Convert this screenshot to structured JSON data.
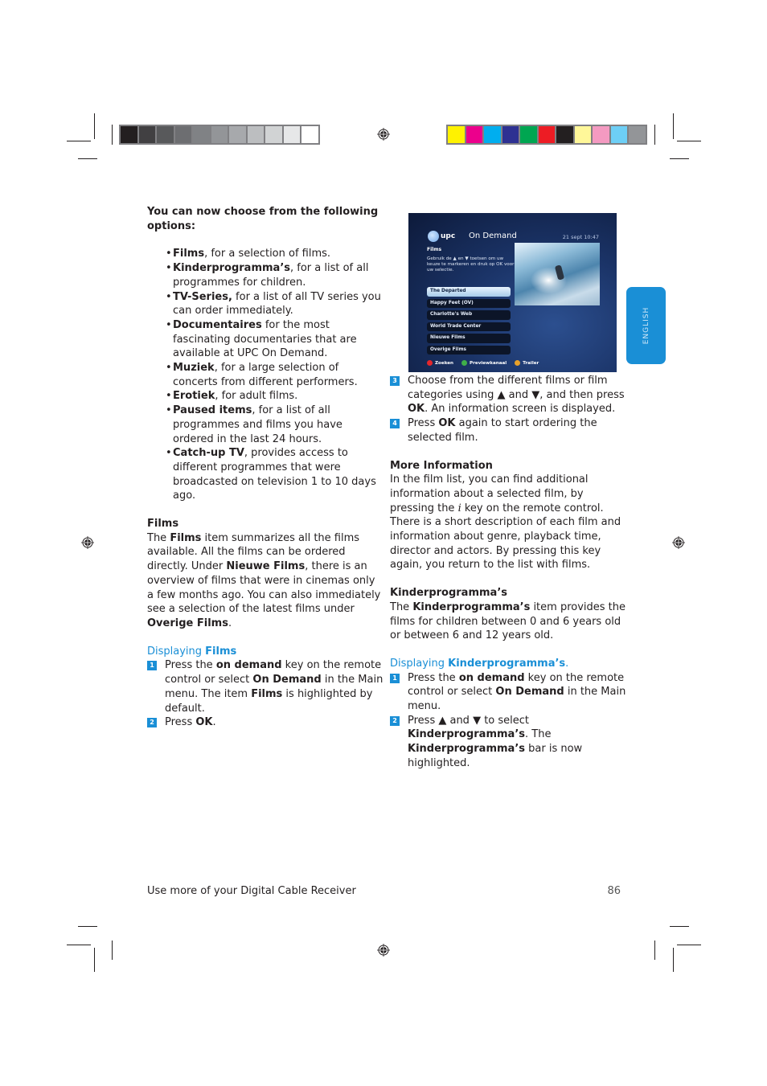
{
  "print_marks": {
    "grayscale_swatches": [
      "#231f20",
      "#414042",
      "#58595b",
      "#6d6e71",
      "#808285",
      "#939598",
      "#a7a9ac",
      "#bcbec0",
      "#d1d3d4",
      "#e6e7e8",
      "#ffffff"
    ],
    "color_swatches": [
      "#fff200",
      "#ec008c",
      "#00aeef",
      "#2e3192",
      "#00a651",
      "#ed1c24",
      "#231f20",
      "#fff799",
      "#f49ac1",
      "#6dcff6",
      "#939598"
    ]
  },
  "left_column": {
    "intro": "You can now choose from the following options:",
    "options": [
      {
        "bold": "Films",
        "text": ", for a selection of films."
      },
      {
        "bold": "Kinderprogramma’s",
        "text": ", for a list of all programmes for children."
      },
      {
        "bold": "TV-Series,",
        "text": " for a list of all TV series you can order immediately."
      },
      {
        "bold": "Documentaires",
        "text": " for the most fascinating documentaries that are available at UPC On Demand."
      },
      {
        "bold": "Muziek",
        "text": ", for a large selection of concerts from different performers."
      },
      {
        "bold": "Erotiek",
        "text": ", for adult films."
      },
      {
        "bold": "Paused items",
        "text": ", for a list of all programmes and films you have ordered in the last 24 hours."
      },
      {
        "bold": "Catch-up TV",
        "text": ", provides access to different programmes that were broadcasted on television 1 to 10 days ago."
      }
    ],
    "films": {
      "heading": "Films",
      "p1": "The ",
      "p1_bold": "Films",
      "p2": " item summarizes all the films available. All the films can be ordered directly. Under ",
      "p2_bold": "Nieuwe Films",
      "p3": ", there is an overview of films that were in cinemas only a few months ago. You can also immediately see a selection of the latest films under ",
      "p3_bold": "Overige Films",
      "p4": "."
    },
    "displaying_films": {
      "heading_prefix": "Displaying ",
      "heading_bold": "Films",
      "steps": [
        {
          "num": "1",
          "t1": "Press the ",
          "b1": "on demand",
          "t2": " key on the remote control or select ",
          "b2": "On Demand",
          "t3": " in the Main menu. The item ",
          "b3": "Films",
          "t4": " is highlighted by default."
        },
        {
          "num": "2",
          "t1": "Press ",
          "b1": "OK",
          "t2": "."
        }
      ]
    }
  },
  "tv_screen": {
    "brand": "upc",
    "title": "On Demand",
    "date": "21 sept 10:47",
    "section": "Films",
    "help": "Gebruik de ▲ en ▼ toetsen om uw keuze te markeren en druk op OK voor uw selectie.",
    "menu": [
      {
        "label": "The Departed",
        "selected": true
      },
      {
        "label": "Happy Feet (OV)",
        "selected": false
      },
      {
        "label": "Charlotte's Web",
        "selected": false
      },
      {
        "label": "World Trade Center",
        "selected": false
      },
      {
        "label": "Nieuwe Films",
        "selected": false
      },
      {
        "label": "Overige Films",
        "selected": false
      }
    ],
    "legend": [
      {
        "label": "Zoeken",
        "color": "#e4262b"
      },
      {
        "label": "Previewkanaal",
        "color": "#3fae49"
      },
      {
        "label": "Trailer",
        "color": "#e8a12a"
      }
    ]
  },
  "right_column": {
    "steps": [
      {
        "num": "3",
        "t1": "Choose from the different films or film categories using ▲ and ▼, and then press ",
        "b1": "OK",
        "t2": ". An information screen is displayed."
      },
      {
        "num": "4",
        "t1": "Press ",
        "b1": "OK",
        "t2": " again to start ordering the selected film."
      }
    ],
    "more_info": {
      "heading": "More Information",
      "p1": "In the film list, you can find additional information about a selected film, by pressing the ",
      "i_key": "i",
      "p2": " key on the remote control.",
      "p3": "There is a short description of each film and information about genre, playback time, director and actors. By pressing this key again, you return to the list with films."
    },
    "kinder": {
      "heading": "Kinderprogramma’s",
      "p1": "The ",
      "p1_bold": "Kinderprogramma’s",
      "p2": " item provides the films for children between 0 and 6 years old or between 6 and 12 years old."
    },
    "displaying_kinder": {
      "heading_prefix": "Displaying ",
      "heading_bold": "Kinderprogramma’s",
      "heading_suffix": ".",
      "steps": [
        {
          "num": "1",
          "t1": "Press the ",
          "b1": "on demand",
          "t2": " key on the remote control or select ",
          "b2": "On Demand",
          "t3": " in the Main menu."
        },
        {
          "num": "2",
          "t1": "Press ▲ and ▼ to select ",
          "b1": "Kinderprogramma’s",
          "t2": ". The ",
          "b2": "Kinderprogramma’s",
          "t3": " bar is now highlighted."
        }
      ]
    }
  },
  "language_tab": "ENGLISH",
  "footer": {
    "title": "Use more of your Digital Cable Receiver",
    "page_number": "86"
  }
}
